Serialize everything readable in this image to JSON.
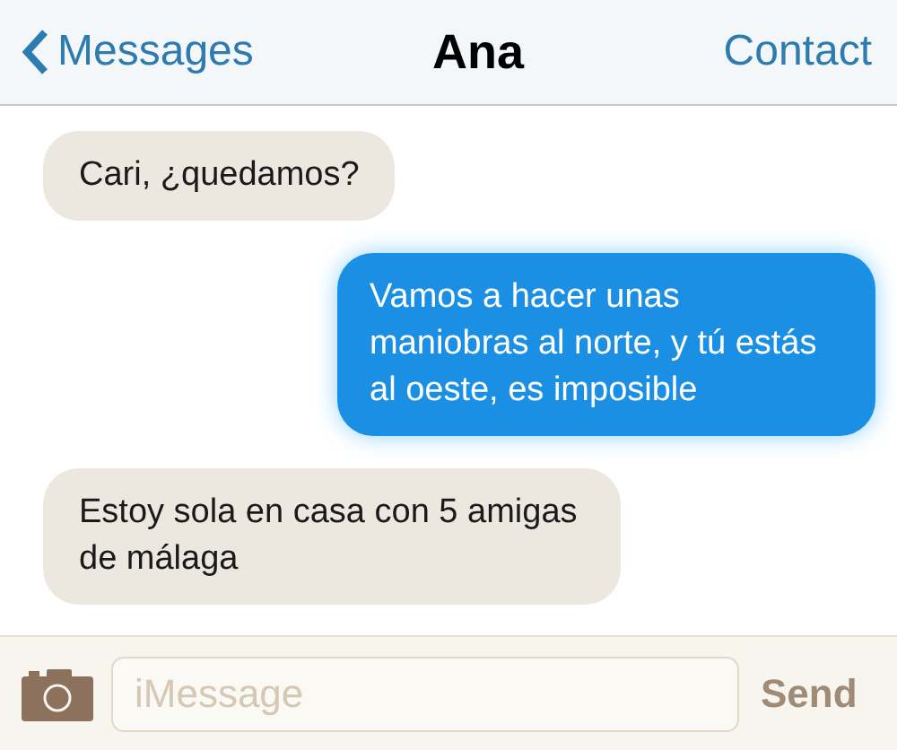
{
  "nav": {
    "back": "Messages",
    "title": "Ana",
    "action": "Contact"
  },
  "messages": [
    {
      "kind": "received",
      "text": "Cari, ¿quedamos?"
    },
    {
      "kind": "sent",
      "text": "Vamos a hacer unas maniobras al norte, y tú estás al oeste, es imposible"
    },
    {
      "kind": "received",
      "text": "Estoy sola en casa con 5 amigas de málaga"
    }
  ],
  "composer": {
    "placeholder": "iMessage",
    "send": "Send"
  }
}
